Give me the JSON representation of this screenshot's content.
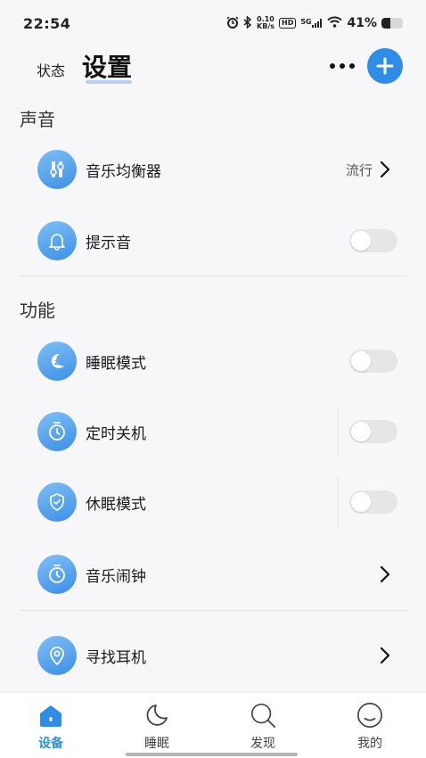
{
  "status_bar": {
    "time": "22:54",
    "net_speed_top": "0.10",
    "net_speed_bottom": "KB/s",
    "hd": "HD",
    "signal": "5G",
    "battery_pct": "41%",
    "battery_level": 0.41
  },
  "header": {
    "tab_status": "状态",
    "tab_settings": "设置"
  },
  "sections": {
    "sound": {
      "title": "声音"
    },
    "features": {
      "title": "功能"
    }
  },
  "rows": {
    "equalizer": {
      "label": "音乐均衡器",
      "value": "流行",
      "icon": "equalizer-icon"
    },
    "prompt_tone": {
      "label": "提示音",
      "toggle": false,
      "icon": "bell-icon"
    },
    "sleep_mode": {
      "label": "睡眠模式",
      "toggle": false,
      "icon": "moon-icon"
    },
    "timer_off": {
      "label": "定时关机",
      "toggle": false,
      "icon": "timer-icon"
    },
    "hibernate_mode": {
      "label": "休眠模式",
      "toggle": false,
      "icon": "shield-icon"
    },
    "music_alarm": {
      "label": "音乐闹钟",
      "icon": "alarm-icon"
    },
    "find_earphones": {
      "label": "寻找耳机",
      "icon": "location-icon"
    }
  },
  "bottom_nav": {
    "items": [
      {
        "label": "设备",
        "icon": "home-icon",
        "active": true
      },
      {
        "label": "睡眠",
        "icon": "moon-icon",
        "active": false
      },
      {
        "label": "发现",
        "icon": "search-icon",
        "active": false
      },
      {
        "label": "我的",
        "icon": "profile-icon",
        "active": false
      }
    ]
  },
  "colors": {
    "accent": "#2f8de8",
    "background": "#f7f7f9",
    "toggle_off": "#e6e6e8"
  }
}
